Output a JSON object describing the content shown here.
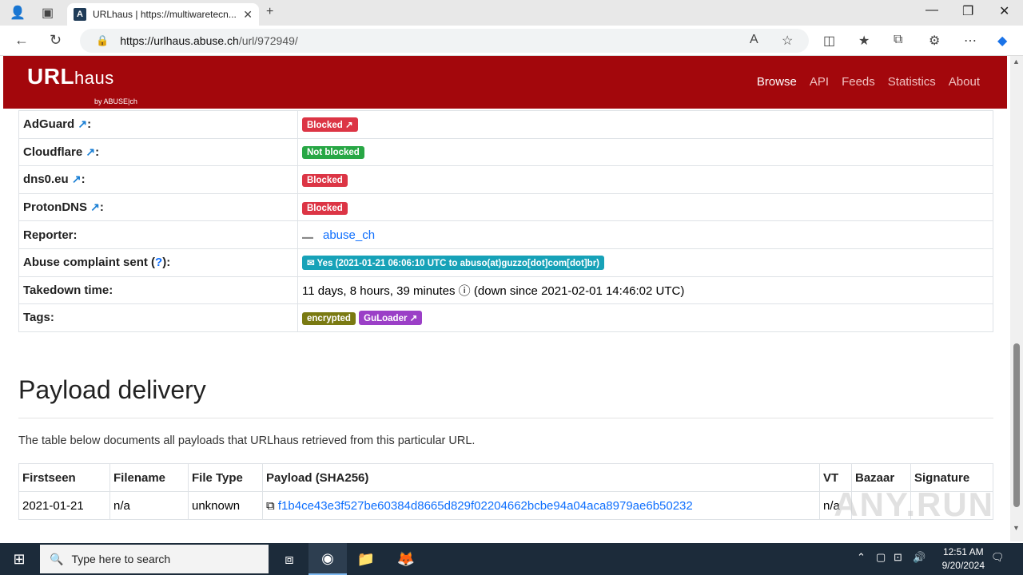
{
  "browser": {
    "tab_title": "URLhaus | https://multiwaretecn...",
    "tab_favicon": "A",
    "url_host": "https://urlhaus.abuse.ch",
    "url_path": "/url/972949/"
  },
  "header": {
    "logo_main": "URL",
    "logo_sub": "haus",
    "logo_by": "by ABUSE|ch",
    "menu": [
      "Browse",
      "API",
      "Feeds",
      "Statistics",
      "About"
    ]
  },
  "info_rows": [
    {
      "key": "AdGuard",
      "value": "Blocked"
    },
    {
      "key": "Cloudflare",
      "value": "Not blocked"
    },
    {
      "key": "dns0.eu",
      "value": "Blocked"
    },
    {
      "key": "ProtonDNS",
      "value": "Blocked"
    },
    {
      "key": "Reporter:",
      "value": "abuse_ch"
    },
    {
      "key": "Abuse complaint sent",
      "help": "?",
      "value": "Yes (2021-01-21 06:06:10 UTC to abuso(at)guzzo[dot]com[dot]br)"
    },
    {
      "key": "Takedown time:",
      "value": "11 days, 8 hours, 39 minutes",
      "extra": "(down since 2021-02-01 14:46:02 UTC)"
    },
    {
      "key": "Tags:",
      "tags": [
        "encrypted",
        "GuLoader"
      ]
    }
  ],
  "payload": {
    "heading": "Payload delivery",
    "description": "The table below documents all payloads that URLhaus retrieved from this particular URL.",
    "columns": [
      "Firstseen",
      "Filename",
      "File Type",
      "Payload (SHA256)",
      "VT",
      "Bazaar",
      "Signature"
    ],
    "rows": [
      {
        "firstseen": "2021-01-21",
        "filename": "n/a",
        "filetype": "unknown",
        "sha256": "f1b4ce43e3f527be60384d8665d829f02204662bcbe94a04aca8979ae6b50232",
        "vt": "n/a",
        "bazaar": "",
        "signature": ""
      }
    ]
  },
  "watermark": "ANY.RUN",
  "taskbar": {
    "search_placeholder": "Type here to search",
    "time": "12:51 AM",
    "date": "9/20/2024"
  },
  "colors": {
    "brand_red": "#a3070c",
    "blocked": "#dc3545",
    "not_blocked": "#28a745",
    "complaint": "#17a2b8"
  }
}
